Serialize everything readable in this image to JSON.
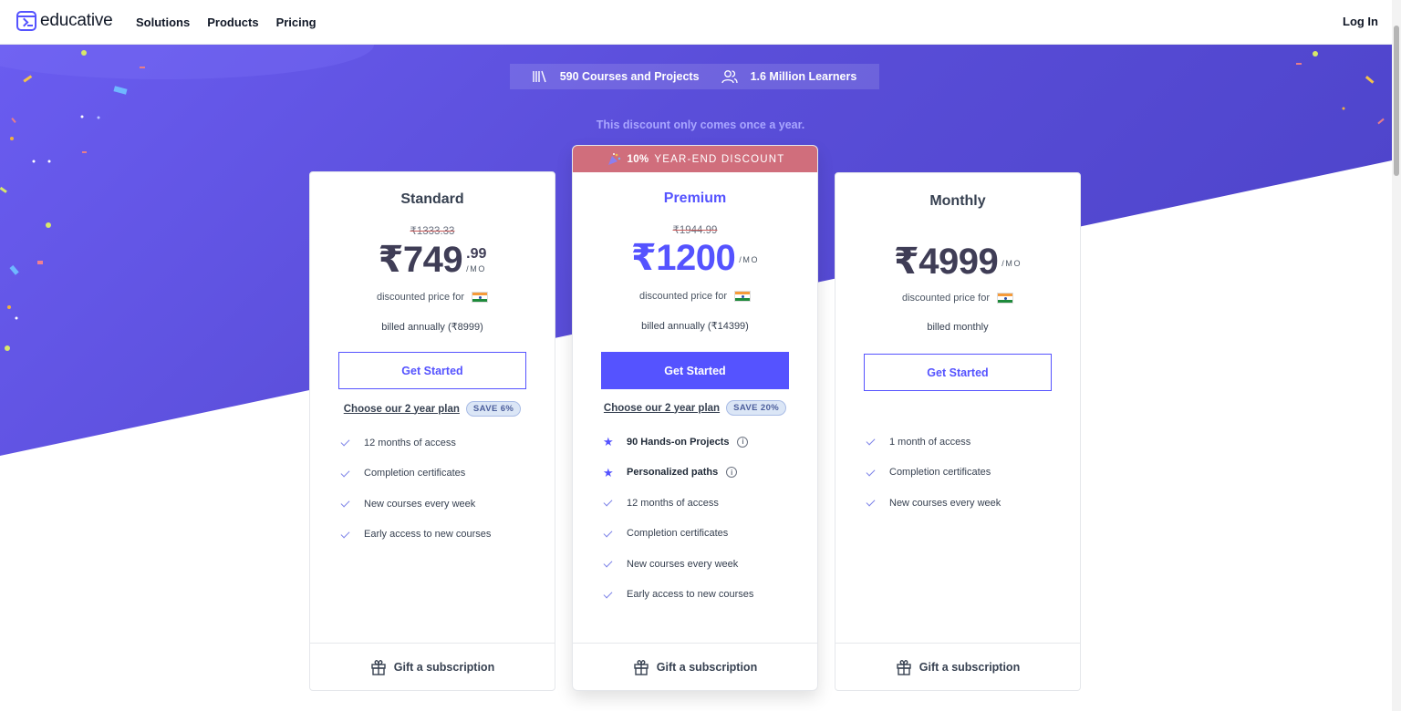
{
  "header": {
    "brand": "educative",
    "nav": [
      "Solutions",
      "Products",
      "Pricing"
    ],
    "login": "Log In"
  },
  "stats": {
    "courses": "590 Courses and Projects",
    "learners": "1.6 Million Learners"
  },
  "tagline": "This discount only comes once a year.",
  "colors": {
    "accent": "#5553ff",
    "hero": "#5b4fd8",
    "banner": "#d06e7c"
  },
  "plans": {
    "standard": {
      "name": "Standard",
      "old_price": "₹1333.33",
      "price": "₹749",
      "cents": ".99",
      "per": "/MO",
      "discounted": "discounted price for",
      "billed": "billed annually (₹8999)",
      "cta": "Get Started",
      "two_year": "Choose our 2 year plan",
      "save": "SAVE 6%",
      "features": [
        "12 months of access",
        "Completion certificates",
        "New courses every week",
        "Early access to new courses"
      ],
      "gift": "Gift a subscription"
    },
    "premium": {
      "banner_pct": "10%",
      "banner_text": "YEAR-END DISCOUNT",
      "name": "Premium",
      "old_price": "₹1944.99",
      "price": "₹1200",
      "per": "/MO",
      "discounted": "discounted price for",
      "billed": "billed annually (₹14399)",
      "cta": "Get Started",
      "two_year": "Choose our 2 year plan",
      "save": "SAVE 20%",
      "highlights": [
        "90 Hands-on Projects",
        "Personalized paths"
      ],
      "features": [
        "12 months of access",
        "Completion certificates",
        "New courses every week",
        "Early access to new courses"
      ],
      "gift": "Gift a subscription"
    },
    "monthly": {
      "name": "Monthly",
      "price": "₹4999",
      "per": "/MO",
      "discounted": "discounted price for",
      "billed": "billed monthly",
      "cta": "Get Started",
      "features": [
        "1 month of access",
        "Completion certificates",
        "New courses every week"
      ],
      "gift": "Gift a subscription"
    }
  }
}
